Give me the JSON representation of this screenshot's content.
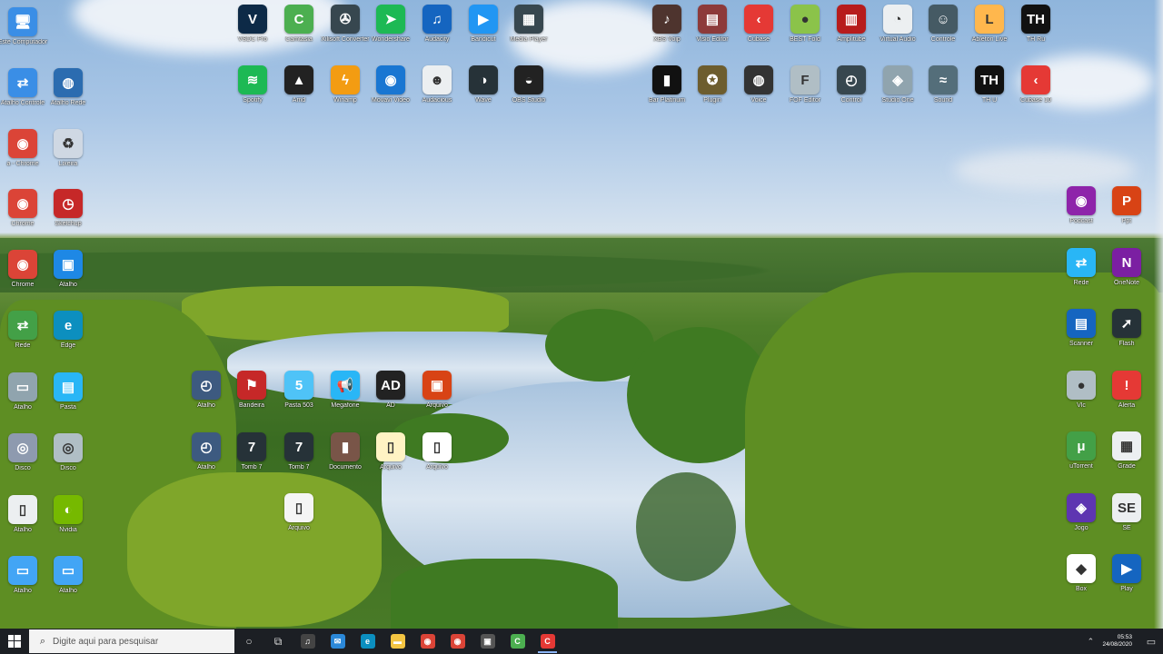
{
  "taskbar": {
    "search_placeholder": "Digite aqui para pesquisar",
    "time": "05:53",
    "date": "24/08/2020"
  },
  "icons": [
    {
      "id": "i01",
      "label": "Este Computador",
      "icon": "computer-icon",
      "color": "#3a8ee6"
    },
    {
      "id": "i02",
      "label": "Atalho Controle",
      "icon": "network-icon",
      "color": "#3a8ee6"
    },
    {
      "id": "i03",
      "label": "Atalho Rede",
      "icon": "globe-icon",
      "color": "#2b6cb0"
    },
    {
      "id": "i04",
      "label": "a - Chrome",
      "icon": "chrome-icon",
      "color": "#db4437"
    },
    {
      "id": "i05",
      "label": "Lixeira",
      "icon": "recycle-bin-icon",
      "color": "#cfd8e3"
    },
    {
      "id": "i06",
      "label": "Chrome",
      "icon": "chrome-icon",
      "color": "#db4437"
    },
    {
      "id": "i07",
      "label": "Sketchup",
      "icon": "clock-icon",
      "color": "#c62828"
    },
    {
      "id": "i08",
      "label": "Chrome",
      "icon": "chrome-icon",
      "color": "#db4437"
    },
    {
      "id": "i09",
      "label": "Atalho",
      "icon": "monitor-user-icon",
      "color": "#1e88e5"
    },
    {
      "id": "i10",
      "label": "Rede",
      "icon": "network-icon",
      "color": "#43a047"
    },
    {
      "id": "i11",
      "label": "Edge",
      "icon": "edge-icon",
      "color": "#0c8fbf"
    },
    {
      "id": "i12",
      "label": "Atalho",
      "icon": "drive-icon",
      "color": "#90a4ae"
    },
    {
      "id": "i13",
      "label": "Pasta",
      "icon": "window-icon",
      "color": "#29b6f6"
    },
    {
      "id": "i14",
      "label": "Disco",
      "icon": "disc-icon",
      "color": "#8e9aaf"
    },
    {
      "id": "i15",
      "label": "Disco",
      "icon": "disc-icon",
      "color": "#b0bec5"
    },
    {
      "id": "i16",
      "label": "Atalho",
      "icon": "file-icon",
      "color": "#eceff1"
    },
    {
      "id": "i17",
      "label": "Nvidia",
      "icon": "nvidia-icon",
      "color": "#76b900"
    },
    {
      "id": "i18",
      "label": "Atalho",
      "icon": "drive-icon",
      "color": "#42a5f5"
    },
    {
      "id": "i19",
      "label": "Atalho",
      "icon": "drive-icon",
      "color": "#42a5f5"
    },
    {
      "id": "i20",
      "label": "VSDC Pro",
      "icon": "v-icon",
      "color": "#0d2a47"
    },
    {
      "id": "i21",
      "label": "Camtasia",
      "icon": "c-icon",
      "color": "#4caf50"
    },
    {
      "id": "i22",
      "label": "Xilisoft Converter",
      "icon": "reel-icon",
      "color": "#37474f"
    },
    {
      "id": "i23",
      "label": "Wondershare",
      "icon": "arrow-icon",
      "color": "#1db954"
    },
    {
      "id": "i24",
      "label": "Audacity",
      "icon": "headphones-icon",
      "color": "#1565c0"
    },
    {
      "id": "i25",
      "label": "Bandicut",
      "icon": "play-icon",
      "color": "#2196f3"
    },
    {
      "id": "i26",
      "label": "Media Player",
      "icon": "calendar-icon",
      "color": "#37474f"
    },
    {
      "id": "i27",
      "label": "Spotify",
      "icon": "spotify-icon",
      "color": "#1db954"
    },
    {
      "id": "i28",
      "label": "Amd",
      "icon": "triangle-icon",
      "color": "#222"
    },
    {
      "id": "i29",
      "label": "Winamp",
      "icon": "bolt-icon",
      "color": "#f39c12"
    },
    {
      "id": "i30",
      "label": "Movavi Video",
      "icon": "movie-icon",
      "color": "#1976d2"
    },
    {
      "id": "i31",
      "label": "Audacious",
      "icon": "alien-icon",
      "color": "#eceff1"
    },
    {
      "id": "i32",
      "label": "Wave",
      "icon": "moon-icon",
      "color": "#263238"
    },
    {
      "id": "i33",
      "label": "OBS Studio",
      "icon": "obs-icon",
      "color": "#222"
    },
    {
      "id": "i34",
      "label": "XBS Voip",
      "icon": "guitar-icon",
      "color": "#4e342e"
    },
    {
      "id": "i35",
      "label": "Visio Editor",
      "icon": "film-icon",
      "color": "#8d3a3a"
    },
    {
      "id": "i36",
      "label": "Cubase",
      "icon": "cubase-icon",
      "color": "#e53935"
    },
    {
      "id": "i37",
      "label": "BEST Fold",
      "icon": "ball-icon",
      "color": "#8bc34a"
    },
    {
      "id": "i38",
      "label": "Amplitube",
      "icon": "amp-icon",
      "color": "#b71c1c"
    },
    {
      "id": "i39",
      "label": "Virtual Audio",
      "icon": "eye-icon",
      "color": "#eceff1"
    },
    {
      "id": "i40",
      "label": "Controle",
      "icon": "mask-icon",
      "color": "#455a64"
    },
    {
      "id": "i41",
      "label": "Ableton Live",
      "icon": "live-icon",
      "color": "#ffb74d"
    },
    {
      "id": "i42",
      "label": "TH Ru",
      "icon": "th-icon",
      "color": "#111"
    },
    {
      "id": "i43",
      "label": "Bar Platinum",
      "icon": "bars-icon",
      "color": "#111"
    },
    {
      "id": "i44",
      "label": "Plugin",
      "icon": "medal-icon",
      "color": "#6d5d2e"
    },
    {
      "id": "i45",
      "label": "Voice",
      "icon": "dial-icon",
      "color": "#333"
    },
    {
      "id": "i46",
      "label": "FOF Editor",
      "icon": "fof-icon",
      "color": "#b0bec5"
    },
    {
      "id": "i47",
      "label": "Control",
      "icon": "gauge-icon",
      "color": "#37474f"
    },
    {
      "id": "i48",
      "label": "Studio One",
      "icon": "studio-icon",
      "color": "#90a4ae"
    },
    {
      "id": "i49",
      "label": "Sound",
      "icon": "wave-icon",
      "color": "#546e7a"
    },
    {
      "id": "i50",
      "label": "TH U",
      "icon": "th-icon",
      "color": "#111"
    },
    {
      "id": "i51",
      "label": "Cubase 10",
      "icon": "cubase-icon",
      "color": "#e53935"
    },
    {
      "id": "i52",
      "label": "Atalho",
      "icon": "gauge-icon",
      "color": "#3d5a80"
    },
    {
      "id": "i53",
      "label": "Bandeira",
      "icon": "flag-icon",
      "color": "#c62828"
    },
    {
      "id": "i54",
      "label": "Pasta 503",
      "icon": "folder-icon",
      "color": "#4fc3f7"
    },
    {
      "id": "i55",
      "label": "Megafone",
      "icon": "megaphone-icon",
      "color": "#29b6f6"
    },
    {
      "id": "i56",
      "label": "AD",
      "icon": "ad-icon",
      "color": "#222"
    },
    {
      "id": "i57",
      "label": "Arquivo",
      "icon": "image-icon",
      "color": "#d84315"
    },
    {
      "id": "i58",
      "label": "Atalho",
      "icon": "gauge-icon",
      "color": "#3d5a80"
    },
    {
      "id": "i59",
      "label": "Tomb 7",
      "icon": "seven-icon",
      "color": "#263238"
    },
    {
      "id": "i60",
      "label": "Tomb 7",
      "icon": "seven-icon",
      "color": "#263238"
    },
    {
      "id": "i61",
      "label": "Documento",
      "icon": "book-icon",
      "color": "#795548"
    },
    {
      "id": "i62",
      "label": "Arquivo",
      "icon": "file-icon",
      "color": "#fff3c4"
    },
    {
      "id": "i63",
      "label": "Arquivo",
      "icon": "file-icon",
      "color": "#fff"
    },
    {
      "id": "i64",
      "label": "Arquivo",
      "icon": "file-icon",
      "color": "#f5f5f5"
    },
    {
      "id": "i65",
      "label": "Podcast",
      "icon": "podcast-icon",
      "color": "#8e24aa"
    },
    {
      "id": "i66",
      "label": "Ppt",
      "icon": "ppt-icon",
      "color": "#d84315"
    },
    {
      "id": "i67",
      "label": "Rede",
      "icon": "network-icon",
      "color": "#29b6f6"
    },
    {
      "id": "i68",
      "label": "OneNote",
      "icon": "note-icon",
      "color": "#7b1fa2"
    },
    {
      "id": "i69",
      "label": "Scanner",
      "icon": "scanner-icon",
      "color": "#1565c0"
    },
    {
      "id": "i70",
      "label": "Flash",
      "icon": "flash-icon",
      "color": "#263238"
    },
    {
      "id": "i71",
      "label": "Vlc",
      "icon": "ball-icon",
      "color": "#b0bec5"
    },
    {
      "id": "i72",
      "label": "Alerta",
      "icon": "alert-icon",
      "color": "#e53935"
    },
    {
      "id": "i73",
      "label": "uTorrent",
      "icon": "utorrent-icon",
      "color": "#43a047"
    },
    {
      "id": "i74",
      "label": "Grade",
      "icon": "grid-icon",
      "color": "#eceff1"
    },
    {
      "id": "i75",
      "label": "Jogo",
      "icon": "game-icon",
      "color": "#5e35b1"
    },
    {
      "id": "i76",
      "label": "SE",
      "icon": "se-icon",
      "color": "#eceff1"
    },
    {
      "id": "i77",
      "label": "Box",
      "icon": "box-icon",
      "color": "#fff"
    },
    {
      "id": "i78",
      "label": "Play",
      "icon": "play-icon",
      "color": "#1565c0"
    }
  ],
  "taskbar_apps": [
    {
      "icon": "music-app-icon",
      "color": "#444"
    },
    {
      "icon": "mail-icon",
      "color": "#2b88d8"
    },
    {
      "icon": "edge-icon",
      "color": "#0c8fbf"
    },
    {
      "icon": "file-explorer-icon",
      "color": "#f4c542"
    },
    {
      "icon": "chrome-icon",
      "color": "#db4437"
    },
    {
      "icon": "chrome-icon",
      "color": "#db4437"
    },
    {
      "icon": "store-icon",
      "color": "#555"
    },
    {
      "icon": "camtasia-icon",
      "color": "#4caf50"
    },
    {
      "icon": "camtasia-recorder-icon",
      "color": "#e53935"
    }
  ]
}
